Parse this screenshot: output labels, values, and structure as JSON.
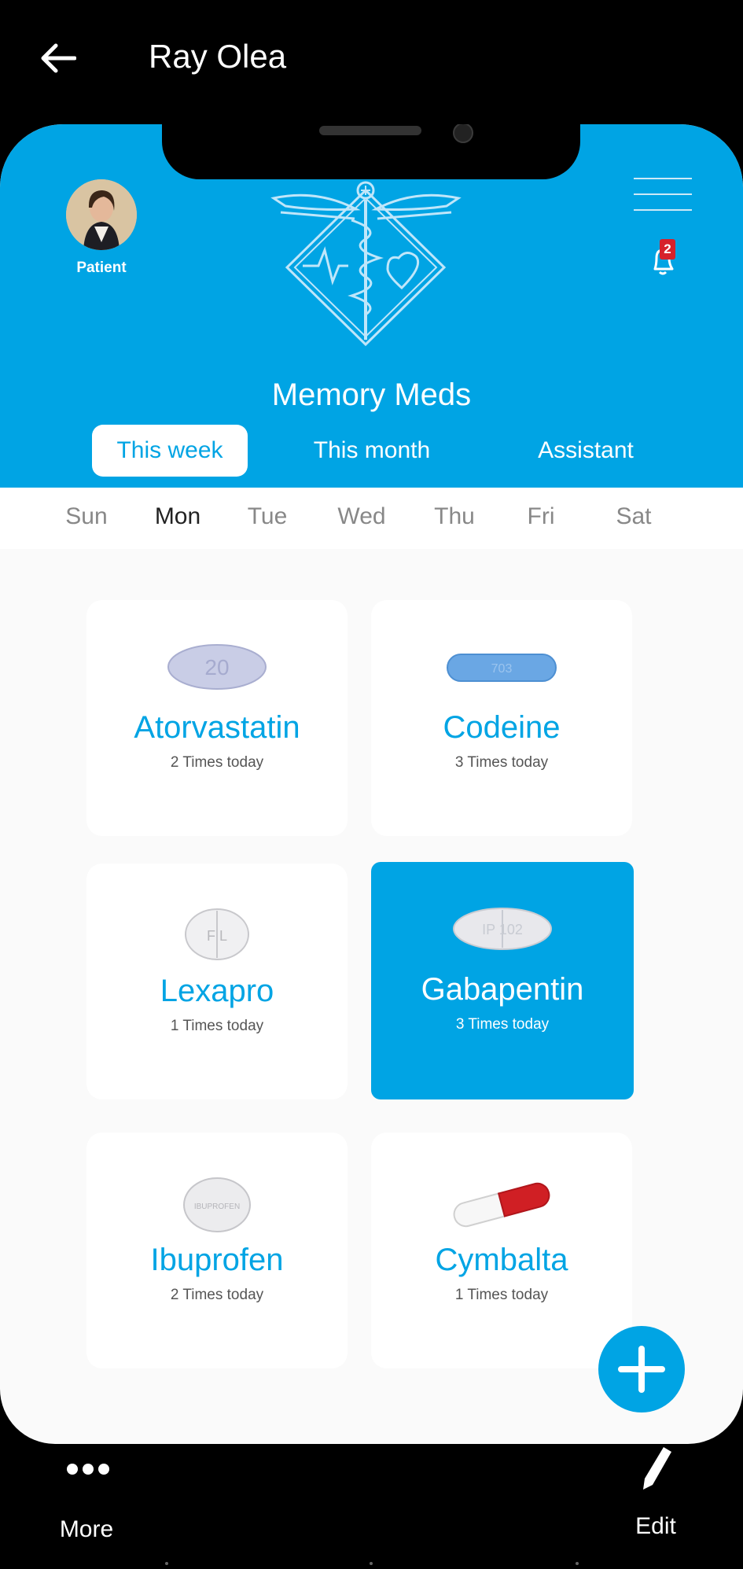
{
  "header": {
    "title": "Ray Olea"
  },
  "app": {
    "patient_label": "Patient",
    "notifications": "2",
    "brand": "Memory Meds",
    "tabs": [
      {
        "label": "This week",
        "active": true
      },
      {
        "label": "This month",
        "active": false
      },
      {
        "label": "Assistant",
        "active": false
      }
    ],
    "days": [
      {
        "label": "Sun",
        "current": false
      },
      {
        "label": "Mon",
        "current": true
      },
      {
        "label": "Tue",
        "current": false
      },
      {
        "label": "Wed",
        "current": false
      },
      {
        "label": "Thu",
        "current": false
      },
      {
        "label": "Fri",
        "current": false
      },
      {
        "label": "Sat",
        "current": false
      }
    ],
    "medications": [
      {
        "name": "Atorvastatin",
        "times": "2 Times today",
        "pill": "oval-lavender",
        "imprint": "20",
        "selected": false
      },
      {
        "name": "Codeine",
        "times": "3 Times today",
        "pill": "capsule-blue",
        "imprint": "703",
        "selected": false
      },
      {
        "name": "Lexapro",
        "times": "1 Times today",
        "pill": "round-white",
        "imprint": "F L",
        "selected": false
      },
      {
        "name": "Gabapentin",
        "times": "3 Times today",
        "pill": "oval-white",
        "imprint": "IP 102",
        "selected": true
      },
      {
        "name": "Ibuprofen",
        "times": "2 Times today",
        "pill": "round-ibuprofen",
        "imprint": "IBUPROFEN",
        "selected": false
      },
      {
        "name": "Cymbalta",
        "times": "1 Times today",
        "pill": "capsule-red-white",
        "imprint": "",
        "selected": false
      }
    ]
  },
  "bottom": {
    "more_label": "More",
    "edit_label": "Edit"
  },
  "colors": {
    "accent": "#00a4e4",
    "badge": "#d6212b"
  }
}
